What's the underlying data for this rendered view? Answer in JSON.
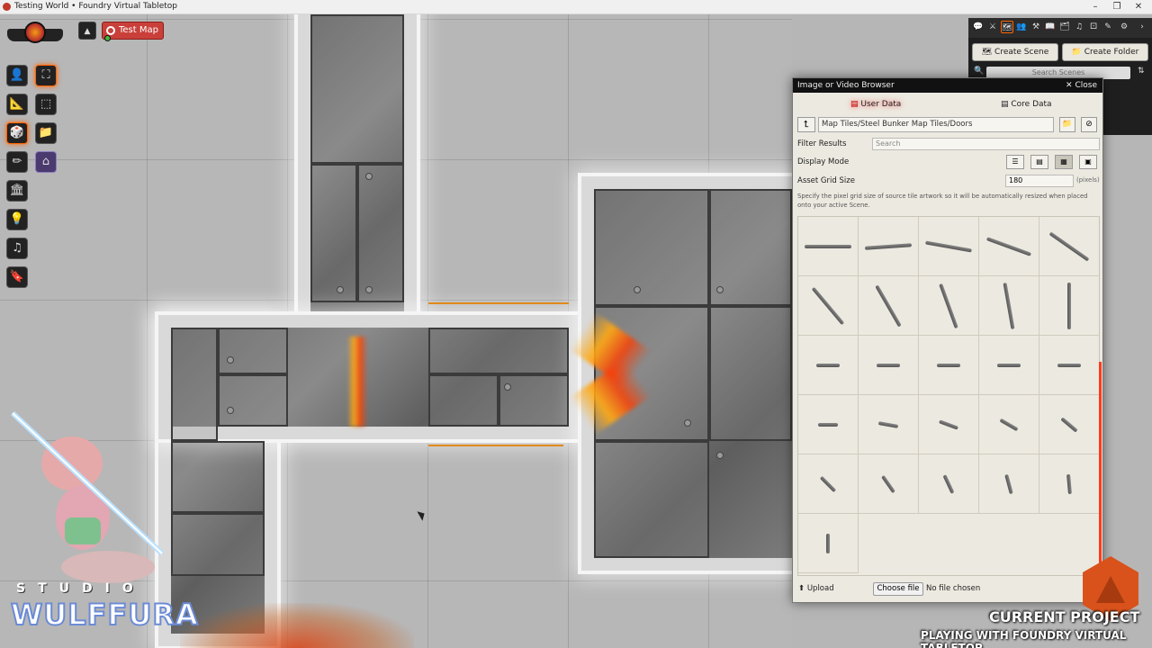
{
  "window": {
    "title": "Testing World • Foundry Virtual Tabletop",
    "minimize": "–",
    "restore": "❐",
    "close": "✕"
  },
  "scene_nav": {
    "active_scene": "Test Map",
    "collapse_glyph": "▲"
  },
  "scene_controls": [
    {
      "name": "token-controls",
      "glyph": "👤"
    },
    {
      "name": "measure-controls",
      "glyph": "📐"
    },
    {
      "name": "tile-controls",
      "glyph": "🎲"
    },
    {
      "name": "drawing-controls",
      "glyph": "✏"
    },
    {
      "name": "wall-controls",
      "glyph": "🏛"
    },
    {
      "name": "lighting-controls",
      "glyph": "💡"
    },
    {
      "name": "sound-controls",
      "glyph": "♫"
    },
    {
      "name": "notes-controls",
      "glyph": "🔖"
    }
  ],
  "sub_controls": [
    {
      "name": "select-tool",
      "glyph": "⛶"
    },
    {
      "name": "tile-browser-tool",
      "glyph": "⬚"
    },
    {
      "name": "folder-tool",
      "glyph": "📁"
    },
    {
      "name": "home-tool",
      "glyph": "⌂"
    }
  ],
  "sidebar": {
    "tabs": [
      "💬",
      "⚔",
      "🗺",
      "👥",
      "⚒",
      "📖",
      "🗂",
      "♫",
      "⚀",
      "✎",
      "⚙",
      "›"
    ],
    "create_scene": "Create Scene",
    "create_folder": "Create Folder",
    "search_placeholder": "Search Scenes",
    "search_icon": "🔍",
    "sort_icon": "⇅"
  },
  "file_picker": {
    "title": "Image or Video Browser",
    "close_label": "Close",
    "tabs": {
      "user_data": "User Data",
      "core_data": "Core Data"
    },
    "path": "Map Tiles/Steel Bunker Map Tiles/Doors",
    "up_glyph": "⮤",
    "filter_label": "Filter Results",
    "filter_placeholder": "Search",
    "display_mode_label": "Display Mode",
    "display_modes": [
      "☰",
      "▤",
      "▦",
      "▣"
    ],
    "grid_size_label": "Asset Grid Size",
    "grid_size_value": "180",
    "grid_size_units": "(pixels)",
    "hint": "Specify the pixel grid size of source tile artwork so it will be automatically resized when placed onto your active Scene.",
    "upload_label": "Upload",
    "choose_file_label": "Choose file",
    "no_file_label": "No file chosen",
    "tile_angles": [
      0,
      -4,
      10,
      20,
      35,
      50,
      60,
      70,
      80,
      90,
      0,
      0,
      0,
      0,
      0,
      0,
      10,
      20,
      30,
      40,
      45,
      55,
      65,
      75,
      85,
      90
    ]
  },
  "overlay": {
    "studio_text": "STUDIO",
    "studio_logo": "WULFFURA",
    "project_title": "CURRENT PROJECT",
    "project_subtitle": "PLAYING WITH FOUNDRY VIRTUAL TABLETOP"
  }
}
